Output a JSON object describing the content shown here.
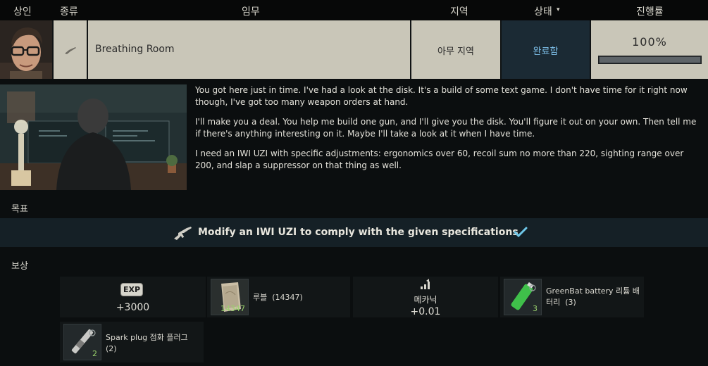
{
  "header": {
    "trader": "상인",
    "type": "종류",
    "quest": "임무",
    "location": "지역",
    "status": "상태",
    "progress": "진행률"
  },
  "quest": {
    "name": "Breathing Room",
    "location": "아무 지역",
    "status": "완료함",
    "progress_text": "100%",
    "progress_fraction": 1.0
  },
  "description": {
    "p1": "You got here just in time. I've had a look at the disk. It's a build of some text game. I don't have time for it right now though, I've got too many weapon orders at hand.",
    "p2": "I'll make you a deal. You help me build one gun, and I'll give you the disk. You'll figure it out on your own. Then tell me if there's anything interesting on it. Maybe I'll take a look at it when I have time.",
    "p3": "I need an IWI UZI with specific adjustments: ergonomics over 60, recoil sum no more than 220, sighting range over 200, and slap a suppressor on that thing as well."
  },
  "objectives": {
    "label": "목표",
    "items": [
      {
        "text": "Modify an IWI UZI to comply with the given specifications",
        "done": true
      }
    ]
  },
  "rewards": {
    "label": "보상",
    "exp_badge": "EXP",
    "exp": "+3000",
    "money_name": "루블",
    "money_qty": "(14347)",
    "money_icon_count": "14347",
    "skill_name": "메카닉",
    "skill_value": "+0.01",
    "battery_name": "GreenBat battery 리튬 배터리",
    "battery_qty": "(3)",
    "battery_count": "3",
    "plug_name": "Spark plug 점화 플러그",
    "plug_qty": "(2)",
    "plug_count": "2"
  },
  "colors": {
    "status_text": "#7fc2ec",
    "count_text": "#9ad26d",
    "checkmark": "#6fc7e8"
  }
}
